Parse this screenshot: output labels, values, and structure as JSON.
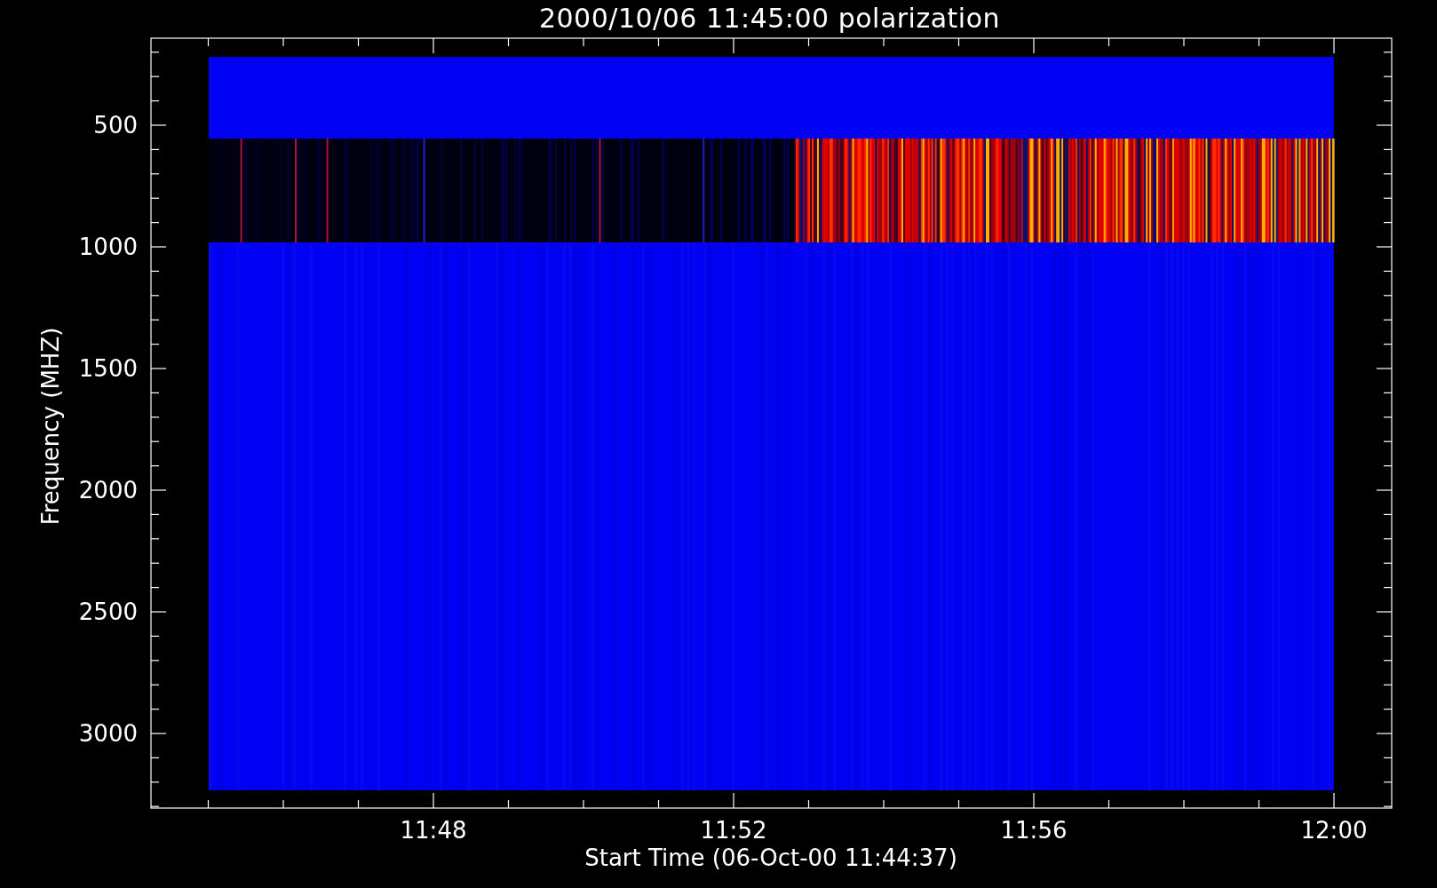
{
  "title": "2000/10/06 11:45:00 polarization",
  "y_axis": {
    "label": "Frequency (MHZ)",
    "ticks": [
      "500",
      "1000",
      "1500",
      "2000",
      "2500",
      "3000"
    ]
  },
  "x_axis": {
    "label": "Start Time (06-Oct-00 11:44:37)",
    "ticks": [
      "11:48",
      "11:52",
      "11:56",
      "12:00"
    ]
  }
}
